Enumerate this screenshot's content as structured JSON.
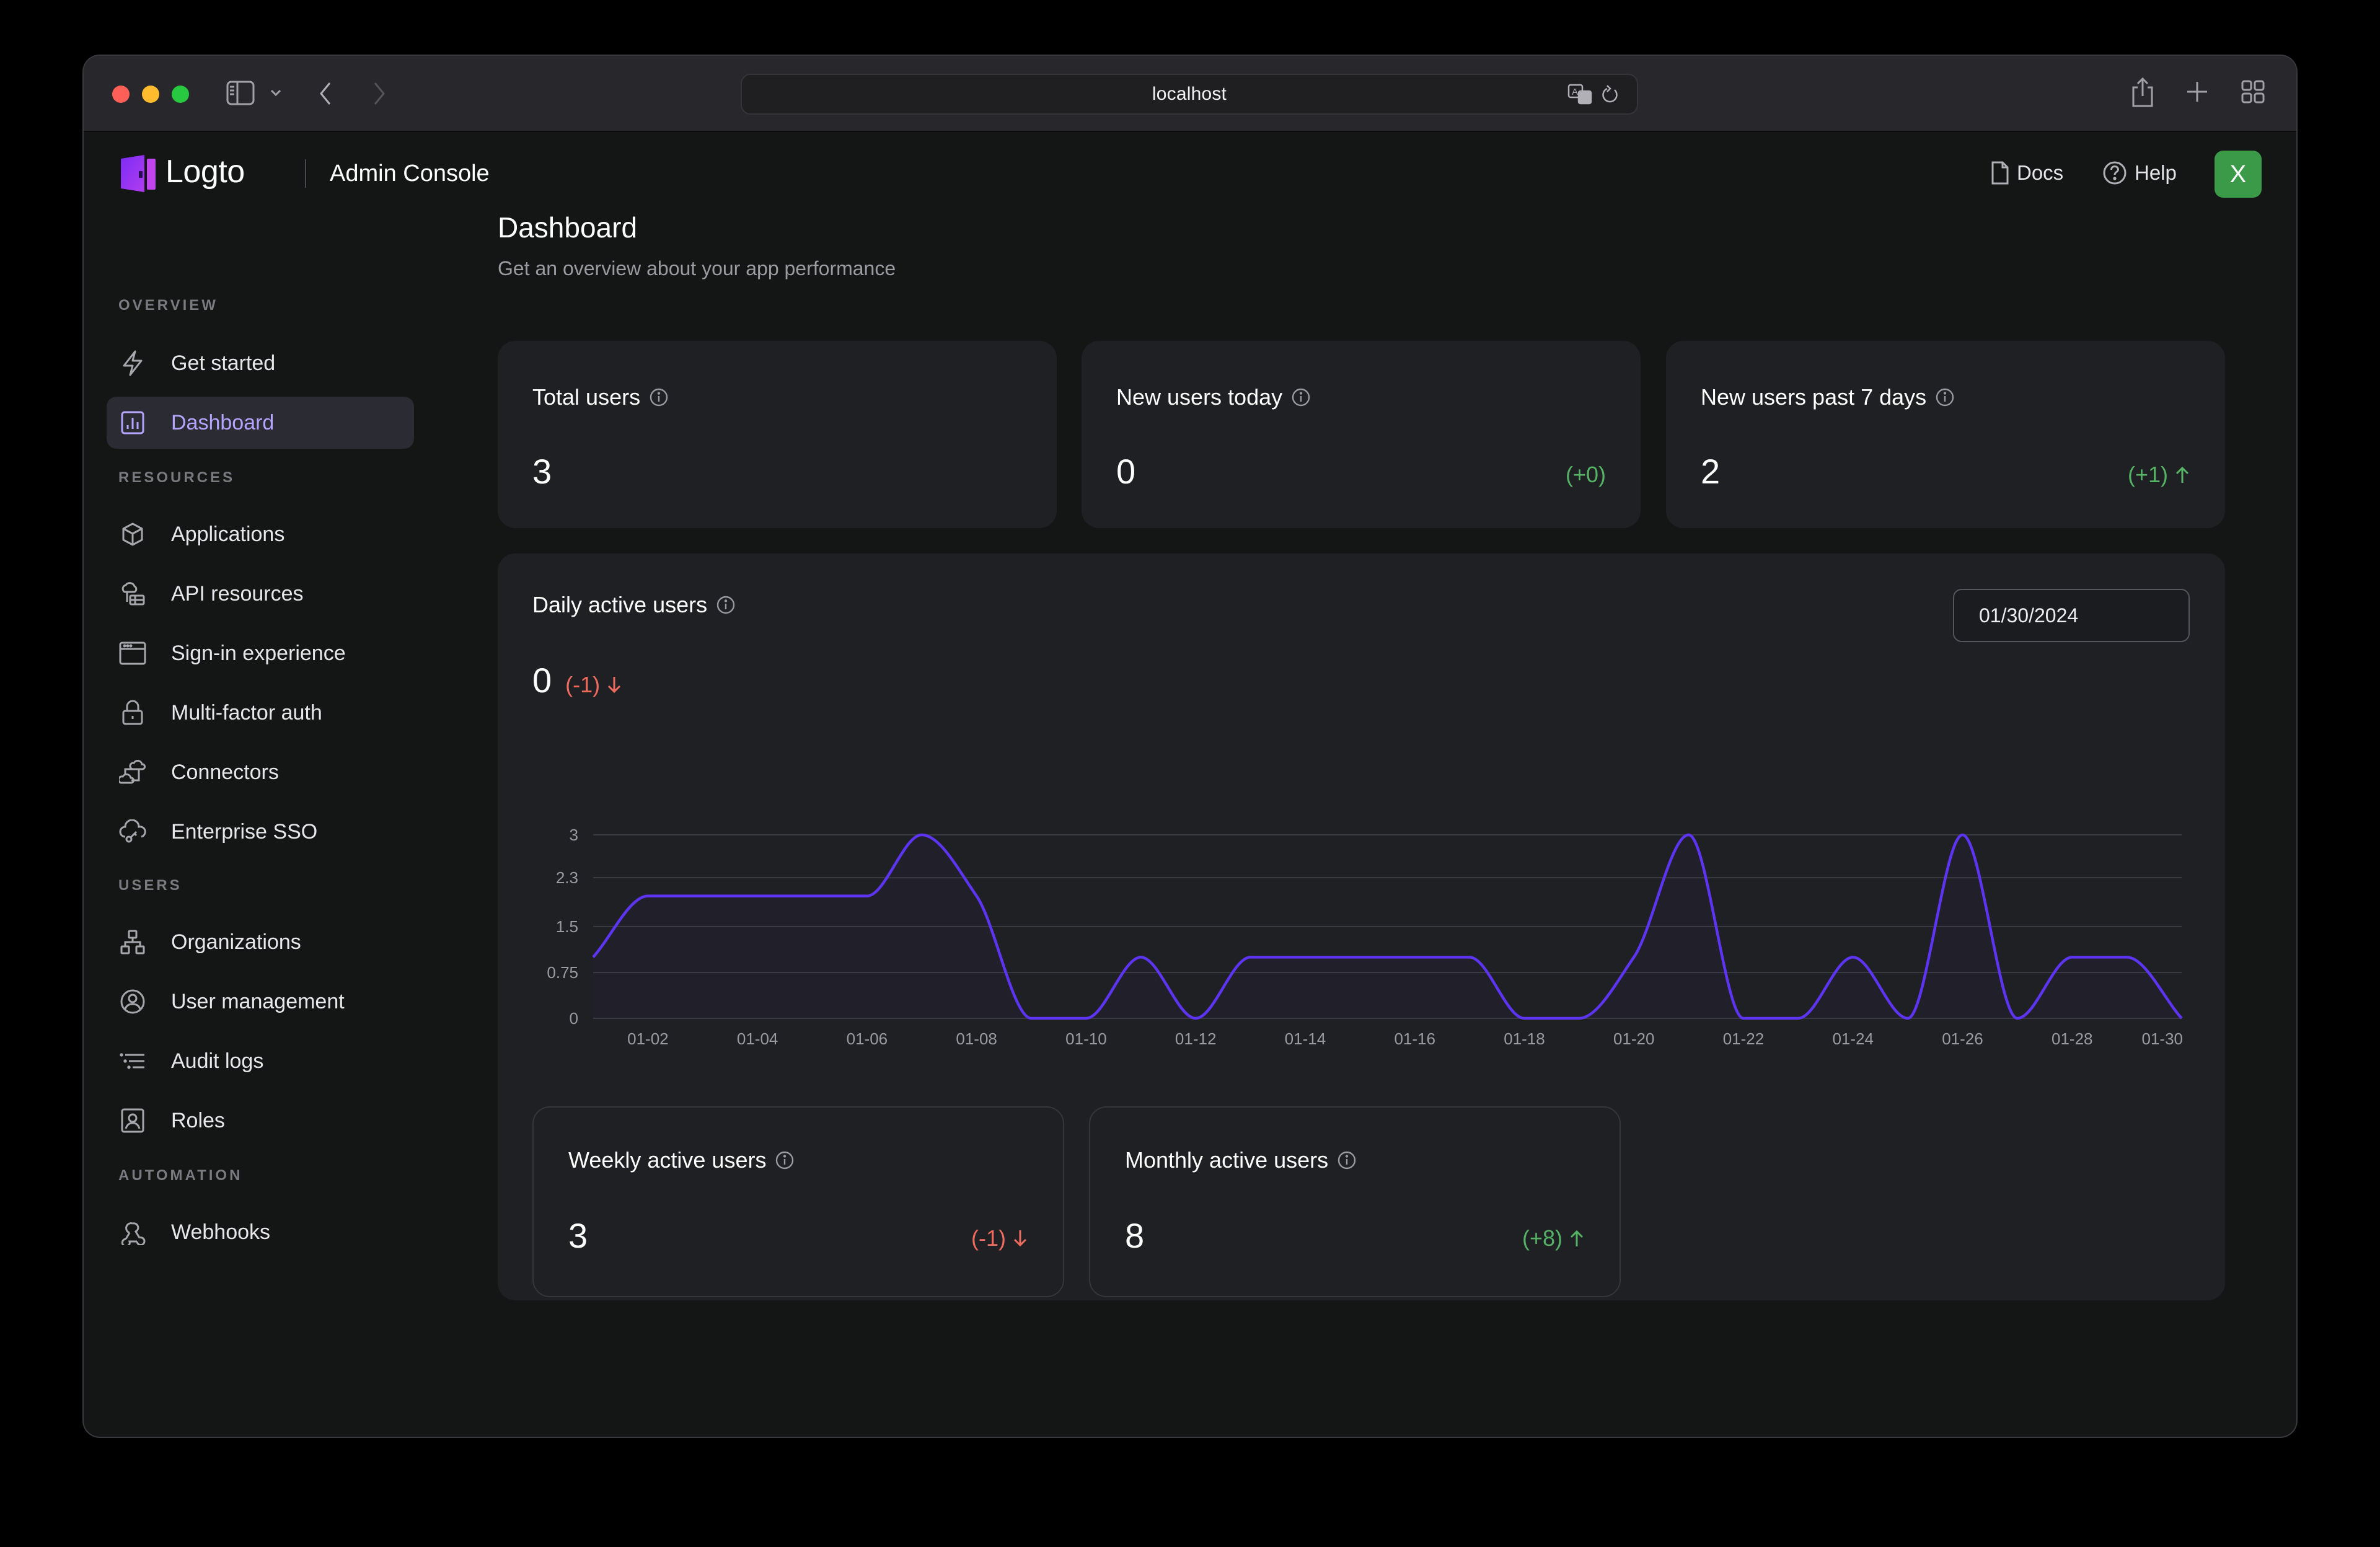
{
  "browser": {
    "url": "localhost"
  },
  "header": {
    "logo_text": "Logto",
    "console_title": "Admin Console",
    "docs_label": "Docs",
    "help_label": "Help",
    "avatar_letter": "X"
  },
  "sidebar": {
    "sections": [
      {
        "label": "OVERVIEW"
      },
      {
        "label": "RESOURCES"
      },
      {
        "label": "USERS"
      },
      {
        "label": "AUTOMATION"
      }
    ],
    "items": [
      {
        "label": "Get started",
        "icon": "lightning-icon",
        "active": false
      },
      {
        "label": "Dashboard",
        "icon": "bar-chart-icon",
        "active": true
      },
      {
        "label": "Applications",
        "icon": "cube-icon",
        "active": false
      },
      {
        "label": "API resources",
        "icon": "cloud-database-icon",
        "active": false
      },
      {
        "label": "Sign-in experience",
        "icon": "browser-window-icon",
        "active": false
      },
      {
        "label": "Multi-factor auth",
        "icon": "lock-icon",
        "active": false
      },
      {
        "label": "Connectors",
        "icon": "connectors-icon",
        "active": false
      },
      {
        "label": "Enterprise SSO",
        "icon": "cloud-key-icon",
        "active": false
      },
      {
        "label": "Organizations",
        "icon": "org-tree-icon",
        "active": false
      },
      {
        "label": "User management",
        "icon": "user-circle-icon",
        "active": false
      },
      {
        "label": "Audit logs",
        "icon": "list-icon",
        "active": false
      },
      {
        "label": "Roles",
        "icon": "user-badge-icon",
        "active": false
      },
      {
        "label": "Webhooks",
        "icon": "webhook-icon",
        "active": false
      }
    ]
  },
  "main": {
    "title": "Dashboard",
    "subtitle": "Get an overview about your app performance",
    "stats": [
      {
        "title": "Total users",
        "value": "3",
        "delta": "",
        "trend": "none"
      },
      {
        "title": "New users today",
        "value": "0",
        "delta": "(+0)",
        "trend": "none"
      },
      {
        "title": "New users past 7 days",
        "value": "2",
        "delta": "(+1)",
        "trend": "up"
      }
    ],
    "daily": {
      "title": "Daily active users",
      "value": "0",
      "delta": "(-1)",
      "trend": "down",
      "date": "01/30/2024"
    },
    "active_stats": [
      {
        "title": "Weekly active users",
        "value": "3",
        "delta": "(-1)",
        "trend": "down"
      },
      {
        "title": "Monthly active users",
        "value": "8",
        "delta": "(+8)",
        "trend": "up"
      }
    ]
  },
  "colors": {
    "accent": "#5d34f2",
    "active_nav": "#b5a4ff",
    "positive": "#56b265",
    "negative": "#f06b5f",
    "avatar": "#3b9a47"
  },
  "chart_data": {
    "type": "line",
    "title": "Daily active users",
    "xlabel": "",
    "ylabel": "",
    "x": [
      "01-01",
      "01-02",
      "01-03",
      "01-04",
      "01-05",
      "01-06",
      "01-07",
      "01-08",
      "01-09",
      "01-10",
      "01-11",
      "01-12",
      "01-13",
      "01-14",
      "01-15",
      "01-16",
      "01-17",
      "01-18",
      "01-19",
      "01-20",
      "01-21",
      "01-22",
      "01-23",
      "01-24",
      "01-25",
      "01-26",
      "01-27",
      "01-28",
      "01-29",
      "01-30"
    ],
    "series": [
      {
        "name": "Daily active users",
        "values": [
          1,
          2,
          2,
          2,
          2,
          2,
          3,
          2,
          0,
          0,
          1,
          0,
          1,
          1,
          1,
          1,
          1,
          0,
          0,
          1,
          3,
          0,
          0,
          1,
          0,
          3,
          0,
          1,
          1,
          0
        ]
      }
    ],
    "x_tick_labels": [
      "01-02",
      "01-04",
      "01-06",
      "01-08",
      "01-10",
      "01-12",
      "01-14",
      "01-16",
      "01-18",
      "01-20",
      "01-22",
      "01-24",
      "01-26",
      "01-28",
      "01-30"
    ],
    "y_ticks": [
      0,
      0.75,
      1.5,
      2.3,
      3
    ],
    "ylim": [
      0,
      3
    ],
    "grid": true,
    "curve": "smooth-monotone",
    "line_color": "#5d34f2"
  }
}
